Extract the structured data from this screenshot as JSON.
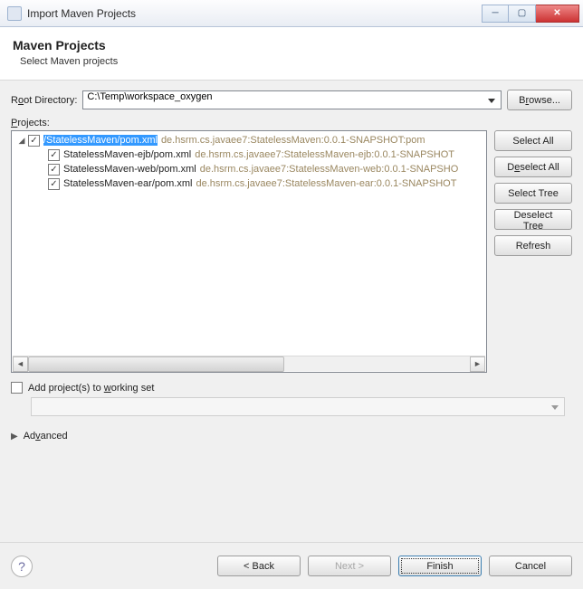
{
  "window": {
    "title": "Import Maven Projects"
  },
  "header": {
    "title": "Maven Projects",
    "subtitle": "Select Maven projects"
  },
  "rootDir": {
    "label_pre": "R",
    "label_u": "o",
    "label_post": "ot Directory:",
    "value": "C:\\Temp\\workspace_oxygen",
    "browse_pre": "B",
    "browse_u": "r",
    "browse_post": "owse..."
  },
  "projects": {
    "label_u": "P",
    "label_post": "rojects:",
    "items": [
      {
        "name": "/StatelessMaven/pom.xml",
        "hint": "de.hsrm.cs.javaee7:StatelessMaven:0.0.1-SNAPSHOT:pom",
        "level": 0,
        "selected": true
      },
      {
        "name": "StatelessMaven-ejb/pom.xml",
        "hint": "de.hsrm.cs.javaee7:StatelessMaven-ejb:0.0.1-SNAPSHOT",
        "level": 1,
        "selected": false
      },
      {
        "name": "StatelessMaven-web/pom.xml",
        "hint": "de.hsrm.cs.javaee7:StatelessMaven-web:0.0.1-SNAPSHO",
        "level": 1,
        "selected": false
      },
      {
        "name": "StatelessMaven-ear/pom.xml",
        "hint": "de.hsrm.cs.javaee7:StatelessMaven-ear:0.0.1-SNAPSHOT",
        "level": 1,
        "selected": false
      }
    ]
  },
  "sideButtons": {
    "selectAll": "Select All",
    "deselectAll_pre": "D",
    "deselectAll_u": "e",
    "deselectAll_post": "select All",
    "selectTree": "Select Tree",
    "deselectTree": "Deselect Tree",
    "refresh": "Refresh"
  },
  "workingSet": {
    "label_pre": "Add project(s) to ",
    "label_u": "w",
    "label_post": "orking set"
  },
  "advanced": {
    "label_pre": "Ad",
    "label_u": "v",
    "label_post": "anced"
  },
  "footer": {
    "back": "< Back",
    "next": "Next >",
    "finish": "Finish",
    "cancel": "Cancel"
  }
}
